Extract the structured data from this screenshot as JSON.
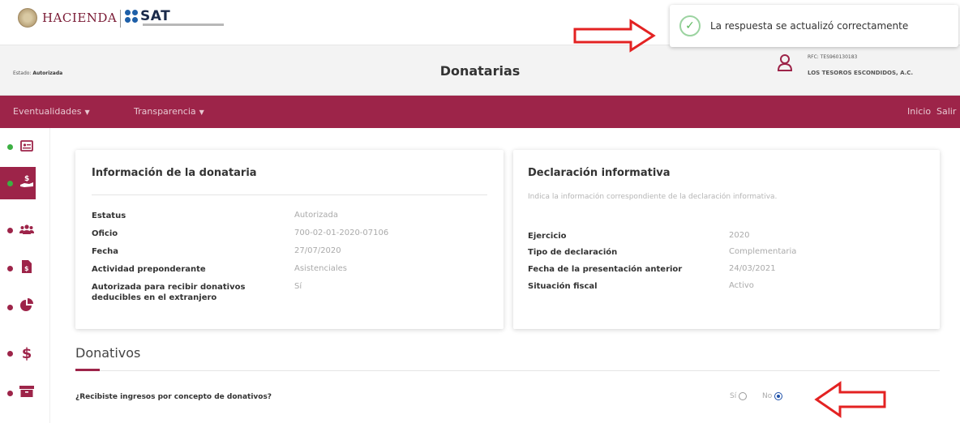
{
  "brand": {
    "hacienda": "HACIENDA",
    "sat": "SAT"
  },
  "header": {
    "estado_label": "Estado:",
    "estado_value": "Autorizada",
    "title": "Donatarias",
    "rfc": "RFC: TES960130183",
    "organization": "LOS TESOROS ESCONDIDOS, A.C.",
    "user_icon": "user-icon"
  },
  "toast": {
    "message": "La respuesta se actualizó correctamente",
    "icon": "check-circle-icon"
  },
  "nav": {
    "menus": [
      {
        "label": "Eventualidades"
      },
      {
        "label": "Transparencia"
      }
    ],
    "right": [
      {
        "label": "Inicio"
      },
      {
        "label": "Salir"
      }
    ]
  },
  "sidebar": {
    "items": [
      {
        "icon": "id-card-icon",
        "dot_color": "#3cb043",
        "active": false
      },
      {
        "icon": "donation-hand-icon",
        "dot_color": "#3cb043",
        "active": true
      },
      {
        "icon": "users-icon",
        "dot_color": "#9d2449",
        "active": false
      },
      {
        "icon": "document-icon",
        "dot_color": "#9d2449",
        "active": false
      },
      {
        "icon": "pie-chart-icon",
        "dot_color": "#9d2449",
        "active": false
      },
      {
        "icon": "dollar-icon",
        "dot_color": "#9d2449",
        "active": false
      },
      {
        "icon": "archive-icon",
        "dot_color": "#9d2449",
        "active": false
      }
    ]
  },
  "donataria": {
    "title": "Información de la donataria",
    "rows": [
      {
        "label": "Estatus",
        "value": "Autorizada"
      },
      {
        "label": "Oficio",
        "value": "700-02-01-2020-07106"
      },
      {
        "label": "Fecha",
        "value": "27/07/2020"
      },
      {
        "label": "Actividad preponderante",
        "value": "Asistenciales"
      },
      {
        "label": "Autorizada para recibir donativos deducibles en el extranjero",
        "value": "Sí"
      }
    ]
  },
  "declaracion": {
    "title": "Declaración informativa",
    "description": "Indica la información correspondiente de la declaración informativa.",
    "rows": [
      {
        "label": "Ejercicio",
        "value": "2020"
      },
      {
        "label": "Tipo de declaración",
        "value": "Complementaria"
      },
      {
        "label": "Fecha de la presentación anterior",
        "value": "24/03/2021"
      },
      {
        "label": "Situación fiscal",
        "value": "Activo"
      }
    ]
  },
  "donativos": {
    "title": "Donativos",
    "question": "¿Recibiste ingresos por concepto de donativos?",
    "options": [
      {
        "label": "Sí",
        "selected": false
      },
      {
        "label": "No",
        "selected": true
      }
    ]
  },
  "colors": {
    "primary": "#9d2449",
    "annotation": "#e32222"
  }
}
